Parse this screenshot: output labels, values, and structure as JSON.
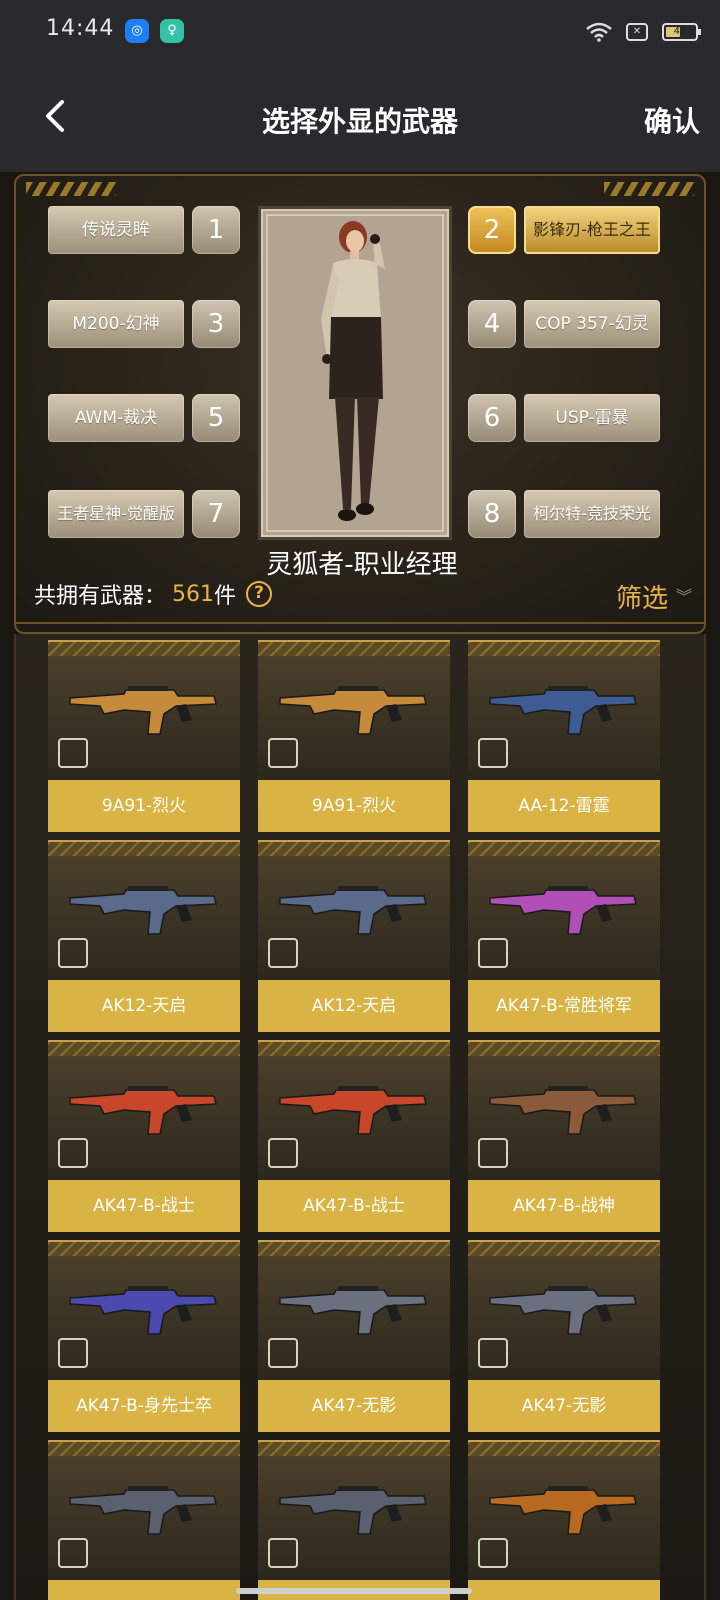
{
  "status": {
    "time": "14:44",
    "battery": "46"
  },
  "header": {
    "title": "选择外显的武器",
    "confirm": "确认"
  },
  "slots": [
    {
      "num": "1",
      "label": "传说灵眸"
    },
    {
      "num": "2",
      "label": "影锋刃-枪王之王",
      "active": true
    },
    {
      "num": "3",
      "label": "M200-幻神"
    },
    {
      "num": "4",
      "label": "COP 357-幻灵"
    },
    {
      "num": "5",
      "label": "AWM-裁决"
    },
    {
      "num": "6",
      "label": "USP-雷暴"
    },
    {
      "num": "7",
      "label": "王者星神-觉醒版"
    },
    {
      "num": "8",
      "label": "柯尔特-竞技荣光"
    }
  ],
  "character": {
    "name": "灵狐者-职业经理"
  },
  "summary": {
    "count_label": "共拥有武器：",
    "count_value": "561",
    "count_unit": "件",
    "help_icon": "?",
    "filter_label": "筛选"
  },
  "weapons": [
    {
      "name": "9A91-烈火",
      "color": "#c58a3a"
    },
    {
      "name": "9A91-烈火",
      "color": "#c58a3a"
    },
    {
      "name": "AA-12-雷霆",
      "color": "#3d5c94"
    },
    {
      "name": "AK12-天启",
      "color": "#5a6a8a"
    },
    {
      "name": "AK12-天启",
      "color": "#5a6a8a"
    },
    {
      "name": "AK47-B-常胜将军",
      "color": "#b04fb6"
    },
    {
      "name": "AK47-B-战士",
      "color": "#c8462a"
    },
    {
      "name": "AK47-B-战士",
      "color": "#c8462a"
    },
    {
      "name": "AK47-B-战神",
      "color": "#8a5a3a"
    },
    {
      "name": "AK47-B-身先士卒",
      "color": "#4a4ab0"
    },
    {
      "name": "AK47-无影",
      "color": "#6a7080"
    },
    {
      "name": "AK47-无影",
      "color": "#6a7080"
    },
    {
      "name": "",
      "color": "#5a6070"
    },
    {
      "name": "",
      "color": "#5a6070"
    },
    {
      "name": "",
      "color": "#b86a20"
    }
  ]
}
